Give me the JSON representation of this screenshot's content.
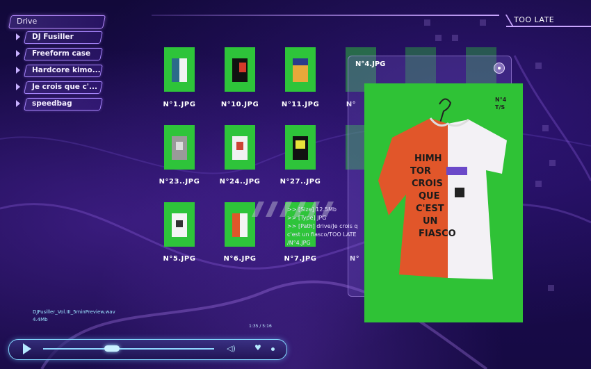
{
  "sidebar": {
    "drive_label": "Drive",
    "folders": [
      {
        "label": "DJ Fusiller"
      },
      {
        "label": "Freeform case"
      },
      {
        "label": "Hardcore kimo..."
      },
      {
        "label": "Je crois que c'..."
      },
      {
        "label": "speedbag"
      }
    ]
  },
  "header": {
    "title": "TOO LATE"
  },
  "grid": {
    "items": [
      {
        "label": "N°1.JPG"
      },
      {
        "label": "N°10.JPG"
      },
      {
        "label": "N°11.JPG"
      },
      {
        "label": "N°"
      },
      {
        "label": "N°23..JPG"
      },
      {
        "label": "N°24..JPG"
      },
      {
        "label": "N°27..JPG"
      },
      {
        "label": "N°5.JPG"
      },
      {
        "label": "N°6.JPG"
      },
      {
        "label": "N°7.JPG"
      },
      {
        "label": "N°"
      }
    ]
  },
  "preview": {
    "title": "N°4.JPG",
    "tag_line1": "N°4",
    "tag_line2": "T/S",
    "info_size": ">> [Size] 12.5Mb",
    "info_type": ">> [Type] JPG",
    "info_path1": ">> [Path] drive/Je crois q",
    "info_path2": "c'est un fiasco/TOO LATE",
    "info_path3": "/N°4.JPG"
  },
  "player": {
    "track_name": "DJFusiller_Vol.III_5minPreview.wav",
    "track_size": "4.4Mb",
    "time": "1:35 / 5:16",
    "accent": "#84d8ff"
  },
  "colors": {
    "thumb_bg": "#2ec43a",
    "accent_purple": "#b78cff"
  }
}
